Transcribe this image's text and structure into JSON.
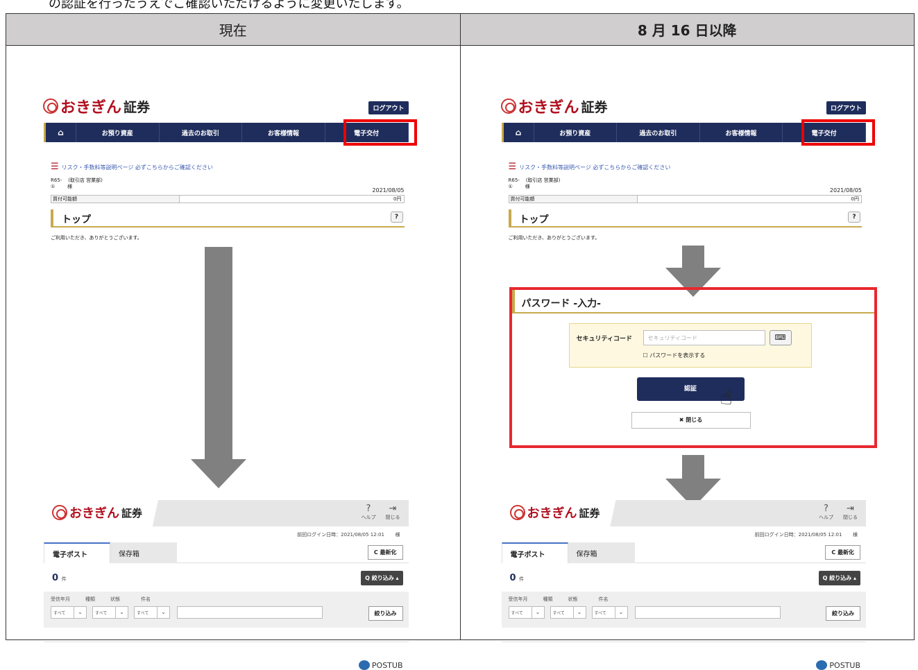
{
  "intro_text": "の認証を行ったうえでご確認いただけるように変更いたします。",
  "headers": {
    "current": "現在",
    "after": "8 月 16 日以降"
  },
  "site": {
    "brand_red": "おきぎん",
    "brand_black": "証券",
    "logout": "ログアウト",
    "nav": {
      "home": "⌂",
      "assets": "お預り資産",
      "history": "過去のお取引",
      "customer": "お客様情報",
      "edoc": "電子交付"
    },
    "risk_link": "リスク・手数料等説明ページ 必ずこちらからご確認ください",
    "account_id": "R65-",
    "branch": "(取引店 営業部)",
    "sama": "様",
    "date": "2021/08/05",
    "buying_power_label": "買付可能額",
    "buying_power_value": "0円",
    "top_title": "トップ",
    "thanks": "ご利用いただき、ありがとうございます。"
  },
  "post": {
    "help": "ヘルプ",
    "close": "閉じる",
    "last_login": "前回ログイン日時：2021/08/05 12:01",
    "sama": "様",
    "tab_post": "電子ポスト",
    "tab_storage": "保存箱",
    "refresh": "C 最新化",
    "count": "0",
    "count_unit": "件",
    "filter": "Q 絞り込み ▴",
    "filter_labels": [
      "受信年月",
      "種類",
      "状態",
      "件名"
    ],
    "select_all": "すべて",
    "filter_button": "絞り込み",
    "postub": "POSTUB"
  },
  "password": {
    "title": "パスワード -入力-",
    "security_label": "セキュリティコード",
    "security_placeholder": "セキュリティコード",
    "show_password": "☐ パスワードを表示する",
    "auth_button": "認証",
    "close_button": "✖ 閉じる"
  },
  "colors": {
    "navy": "#1f2d5c",
    "gold": "#c8a94d",
    "red_highlight": "#e00000",
    "arrow": "#808080"
  }
}
